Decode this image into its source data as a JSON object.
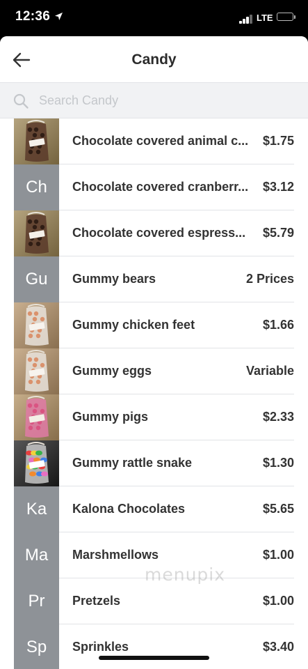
{
  "status_bar": {
    "time": "12:36",
    "network": "LTE"
  },
  "header": {
    "title": "Candy"
  },
  "search": {
    "placeholder": "Search Candy",
    "value": ""
  },
  "items": [
    {
      "name": "Chocolate covered animal c...",
      "price": "$1.75",
      "thumb_type": "photo",
      "icon": "chocolate-bag-photo"
    },
    {
      "name": "Chocolate covered cranberr...",
      "price": "$3.12",
      "thumb_type": "initials",
      "initials": "Ch"
    },
    {
      "name": "Chocolate covered espress...",
      "price": "$5.79",
      "thumb_type": "photo",
      "icon": "chocolate-bag-photo"
    },
    {
      "name": "Gummy bears",
      "price": "2 Prices",
      "thumb_type": "initials",
      "initials": "Gu"
    },
    {
      "name": "Gummy chicken feet",
      "price": "$1.66",
      "thumb_type": "photo",
      "icon": "gummy-bag-photo"
    },
    {
      "name": "Gummy eggs",
      "price": "Variable",
      "thumb_type": "photo",
      "icon": "gummy-bag-photo"
    },
    {
      "name": "Gummy pigs",
      "price": "$2.33",
      "thumb_type": "photo",
      "icon": "pink-gummy-bag-photo"
    },
    {
      "name": "Gummy rattle snake",
      "price": "$1.30",
      "thumb_type": "photo",
      "icon": "colorful-gummy-bag-photo"
    },
    {
      "name": "Kalona Chocolates",
      "price": "$5.65",
      "thumb_type": "initials",
      "initials": "Ka"
    },
    {
      "name": "Marshmellows",
      "price": "$1.00",
      "thumb_type": "initials",
      "initials": "Ma"
    },
    {
      "name": "Pretzels",
      "price": "$1.00",
      "thumb_type": "initials",
      "initials": "Pr"
    },
    {
      "name": "Sprinkles",
      "price": "$3.40",
      "thumb_type": "initials",
      "initials": "Sp"
    }
  ],
  "watermark": "menupix",
  "colors": {
    "initials_bg": "#8e9297",
    "search_bg": "#f1f2f4",
    "text": "#333333"
  }
}
